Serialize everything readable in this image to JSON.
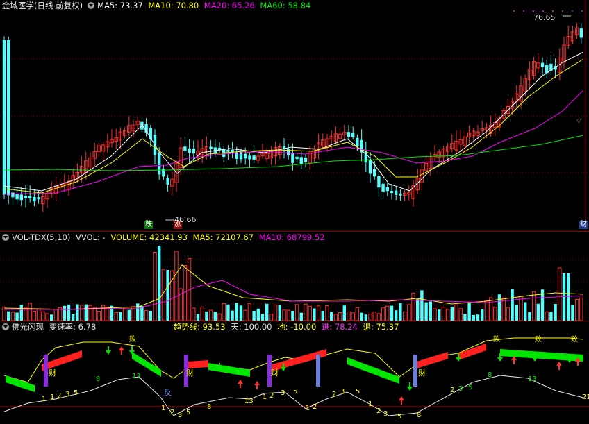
{
  "main": {
    "title": "金域医学(日线 前复权)",
    "ma5": "MA5: 73.37",
    "ma10": "MA10: 70.80",
    "ma20": "MA20: 65.26",
    "ma60": "MA60: 58.84",
    "high_label": "76.65",
    "low_label": "46.66",
    "badge_die": "跌",
    "badge_zhang": "涨",
    "badge_cai": "财",
    "colors": {
      "up": "#ff3232",
      "down": "#54ffff",
      "ma5": "#ffffff",
      "ma10": "#ffff00",
      "ma20": "#ff00ff",
      "ma60": "#00e600"
    }
  },
  "volume": {
    "title": "VOL-TDX(5,10)",
    "vvol": "VVOL: -",
    "volume": "VOLUME: 42341.93",
    "ma5": "MA5: 72107.67",
    "ma10": "MA10: 68799.52"
  },
  "indicator": {
    "title": "佛光闪现",
    "speed": "变速率: 6.78",
    "trend": "趋势线: 93.53",
    "tian": "天: 100.00",
    "di": "地: -10.00",
    "jin": "进: 78.24",
    "tui": "退: 75.37",
    "markers": {
      "cai": "财",
      "fan": "反",
      "bai": "败"
    }
  }
}
